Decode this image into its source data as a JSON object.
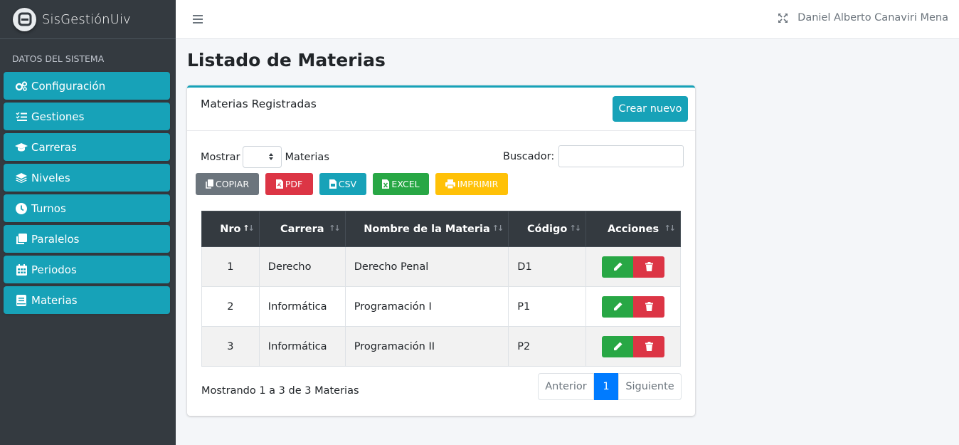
{
  "brand": {
    "name": "SisGestiónUiv"
  },
  "sidebar": {
    "header": "DATOS DEL SISTEMA",
    "items": [
      {
        "label": "Configuración",
        "icon": "gears-icon"
      },
      {
        "label": "Gestiones",
        "icon": "list-check-icon"
      },
      {
        "label": "Carreras",
        "icon": "graduation-cap-icon"
      },
      {
        "label": "Niveles",
        "icon": "layer-group-icon"
      },
      {
        "label": "Turnos",
        "icon": "clock-icon"
      },
      {
        "label": "Paralelos",
        "icon": "clone-icon"
      },
      {
        "label": "Periodos",
        "icon": "calendar-icon"
      },
      {
        "label": "Materias",
        "icon": "book-icon"
      }
    ]
  },
  "navbar": {
    "user": "Daniel Alberto Canaviri Mena"
  },
  "page": {
    "title": "Listado de Materias"
  },
  "card": {
    "title": "Materias Registradas",
    "create_label": "Crear nuevo"
  },
  "controls": {
    "show_label": "Mostrar",
    "show_suffix": "Materias",
    "search_label": "Buscador:",
    "search_value": ""
  },
  "export": {
    "copy": "COPIAR",
    "pdf": "PDF",
    "csv": "CSV",
    "excel": "EXCEL",
    "print": "IMPRIMIR"
  },
  "table": {
    "headers": [
      "Nro",
      "Carrera",
      "Nombre de la Materia",
      "Código",
      "Acciones"
    ],
    "rows": [
      [
        "1",
        "Derecho",
        "Derecho Penal",
        "D1"
      ],
      [
        "2",
        "Informática",
        "Programación I",
        "P1"
      ],
      [
        "3",
        "Informática",
        "Programación II",
        "P2"
      ]
    ]
  },
  "footer": {
    "info": "Mostrando 1 a 3 de 3 Materias",
    "prev": "Anterior",
    "page": "1",
    "next": "Siguiente"
  },
  "colors": {
    "accent": "#17a2b8",
    "sidebar_bg": "#343a40",
    "success": "#28a745",
    "danger": "#dc3545",
    "warning": "#ffc107",
    "primary": "#007bff"
  }
}
